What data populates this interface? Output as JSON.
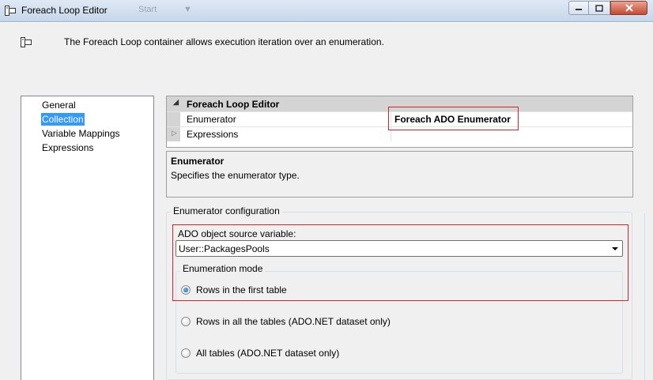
{
  "window": {
    "title": "Foreach Loop Editor",
    "ghost_items": [
      "Start",
      "▼"
    ]
  },
  "header": {
    "description": "The Foreach Loop container allows execution iteration over an enumeration."
  },
  "nav": {
    "items": [
      "General",
      "Collection",
      "Variable Mappings",
      "Expressions"
    ],
    "selected": "Collection"
  },
  "property_grid": {
    "category": "Foreach Loop Editor",
    "rows": [
      {
        "name": "Enumerator",
        "value": "Foreach ADO Enumerator"
      },
      {
        "name": "Expressions",
        "value": ""
      }
    ]
  },
  "description_pane": {
    "title": "Enumerator",
    "text": "Specifies the enumerator type."
  },
  "enumerator_config": {
    "group_label": "Enumerator configuration",
    "source_label": "ADO object source variable:",
    "source_value": "User::PackagesPools",
    "mode_label": "Enumeration mode",
    "modes": [
      {
        "label": "Rows in the first table",
        "checked": true
      },
      {
        "label": "Rows in all the tables (ADO.NET dataset only)",
        "checked": false
      },
      {
        "label": "All tables (ADO.NET dataset only)",
        "checked": false
      }
    ]
  },
  "colors": {
    "selection": "#3399ff",
    "highlight_box": "#d9222a",
    "category_bg": "#d4d4d4"
  }
}
